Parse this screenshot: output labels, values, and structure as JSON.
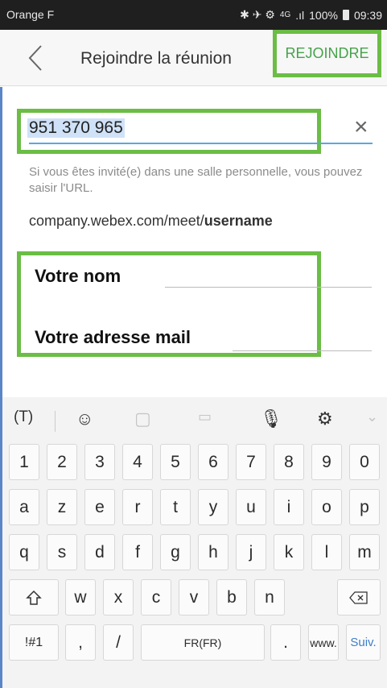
{
  "status_bar": {
    "carrier": "Orange F",
    "icons": "✱ ✈ ⚙",
    "network": "4G",
    "signal": ".ıl",
    "battery": "100%",
    "time": "09:39"
  },
  "header": {
    "title": "Rejoindre la réunion",
    "join_label": "REJOINDRE"
  },
  "form": {
    "meeting_number": "951 370 965",
    "helper_text": "Si vous êtes invité(e) dans une salle personnelle, vous pouvez saisir l'URL.",
    "url_prefix": "company.webex.com/meet/",
    "url_suffix": "username",
    "name_label": "Votre nom",
    "email_label": "Votre adresse mail"
  },
  "keyboard": {
    "toolbar_icons": [
      "text-cursor-icon",
      "smiley-icon",
      "sticker-icon",
      "gif-icon",
      "microphone-icon",
      "settings-icon",
      "chevron-down-icon"
    ],
    "number_row": [
      "1",
      "2",
      "3",
      "4",
      "5",
      "6",
      "7",
      "8",
      "9",
      "0"
    ],
    "row1": [
      "a",
      "z",
      "e",
      "r",
      "t",
      "y",
      "u",
      "i",
      "o",
      "p"
    ],
    "row2": [
      "q",
      "s",
      "d",
      "f",
      "g",
      "h",
      "j",
      "k",
      "l",
      "m"
    ],
    "row3": [
      "w",
      "x",
      "c",
      "v",
      "b",
      "n"
    ],
    "bottom": {
      "symbols": "!#1",
      "comma": ",",
      "slash": "/",
      "space": "FR(FR)",
      "period": ".",
      "www": "www.",
      "next": "Suiv."
    }
  },
  "colors": {
    "highlight": "#6bbd45",
    "accent": "#3e7ec8"
  }
}
